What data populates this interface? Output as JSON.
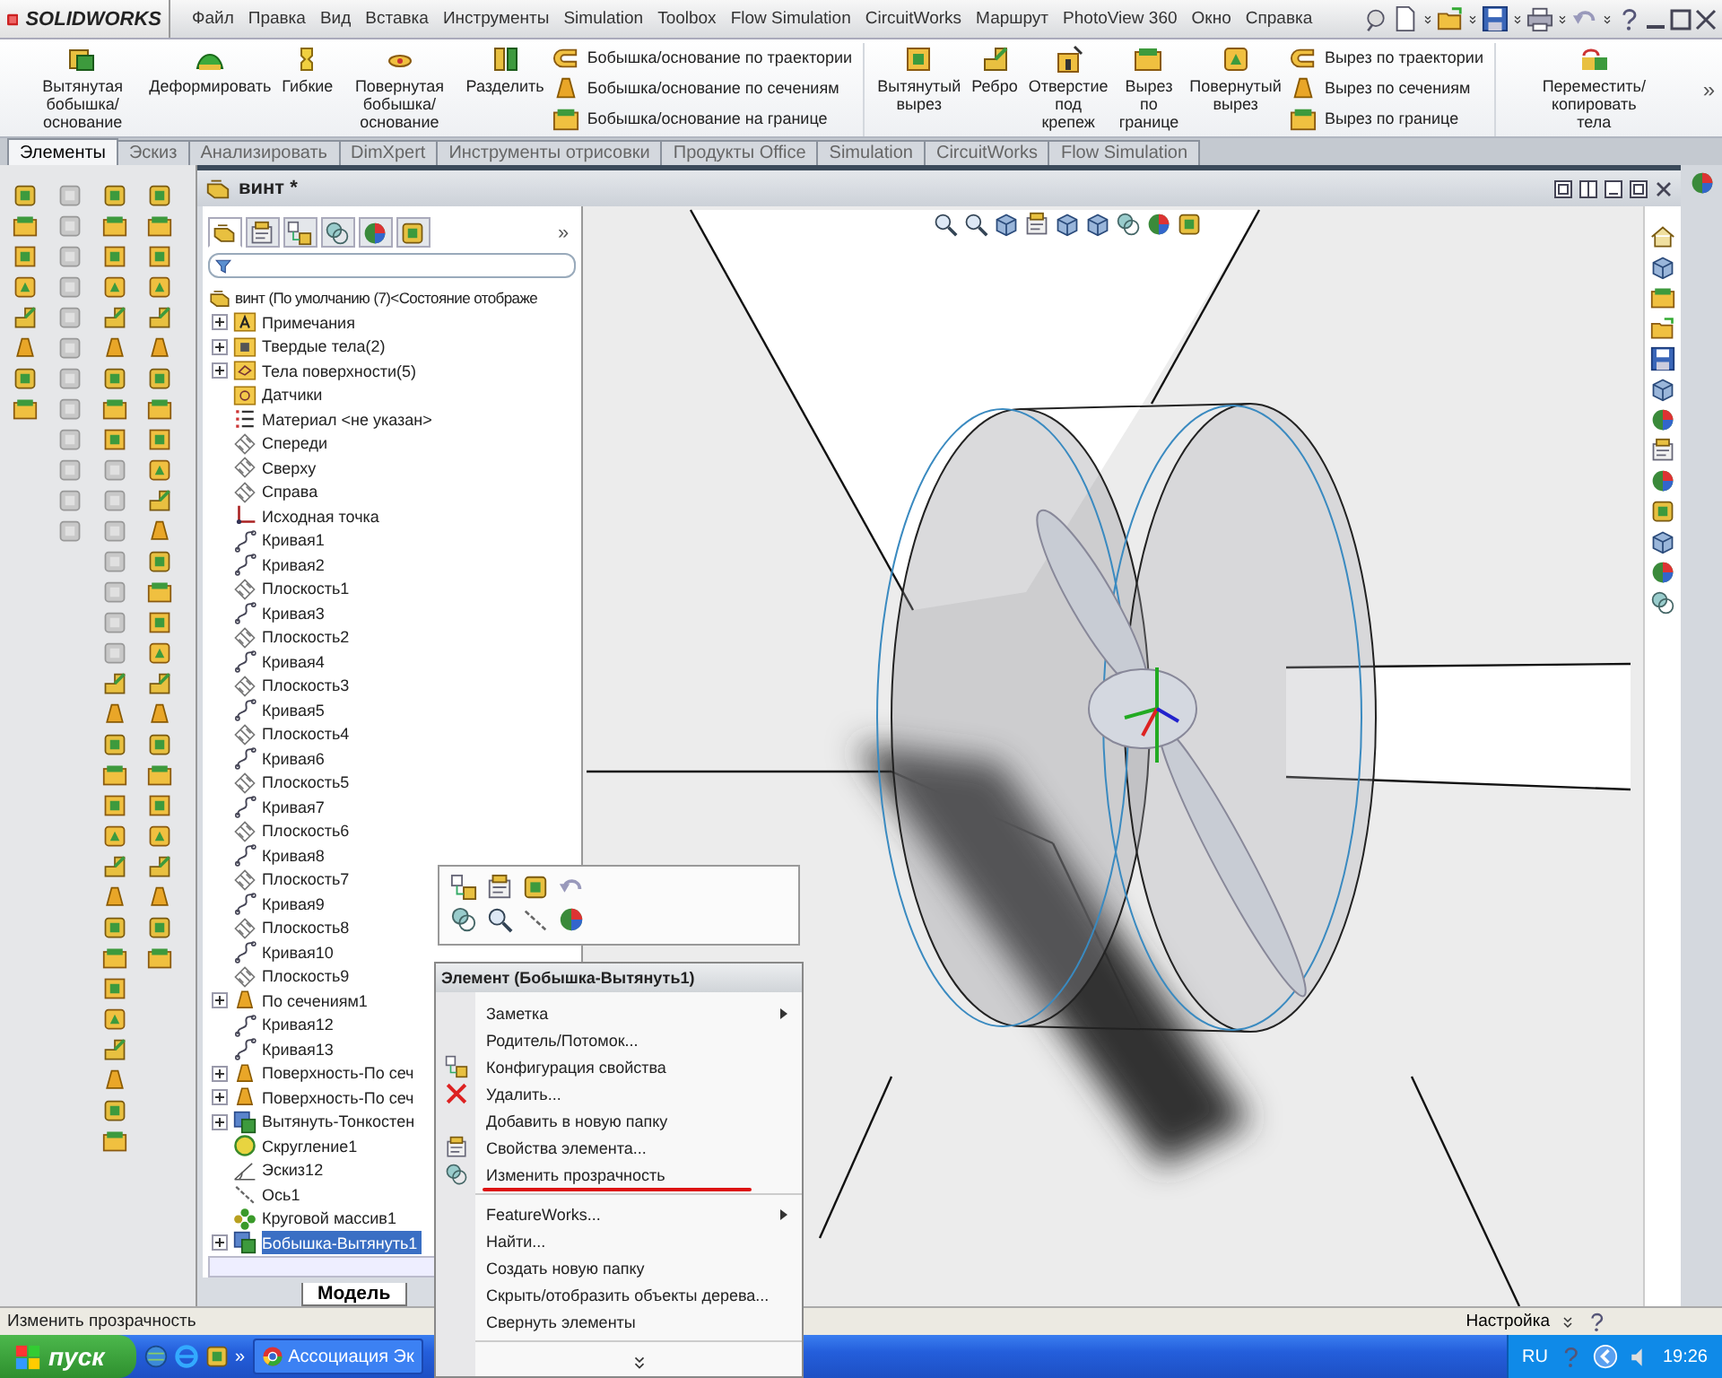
{
  "app": {
    "logo": "SOLIDWORKS",
    "menus": [
      "Файл",
      "Правка",
      "Вид",
      "Вставка",
      "Инструменты",
      "Simulation",
      "Toolbox",
      "Flow Simulation",
      "CircuitWorks",
      "Маршрут",
      "PhotoView 360",
      "Окно",
      "Справка"
    ]
  },
  "ribbon": {
    "groups": [
      {
        "items": [
          {
            "kind": "large",
            "label": "Вытянутая\nбобышка/основание"
          },
          {
            "kind": "large",
            "label": "Деформировать"
          },
          {
            "kind": "large",
            "label": "Гибкие"
          },
          {
            "kind": "large",
            "label": "Повернутая\nбобышка/основание"
          },
          {
            "kind": "large",
            "label": "Разделить"
          },
          {
            "kind": "stack",
            "entries": [
              "Бобышка/основание по траектории",
              "Бобышка/основание по сечениям",
              "Бобышка/основание на границе"
            ]
          }
        ]
      },
      {
        "items": [
          {
            "kind": "large",
            "label": "Вытянутый\nвырез"
          },
          {
            "kind": "large",
            "label": "Ребро"
          },
          {
            "kind": "large",
            "label": "Отверстие\nпод\nкрепеж"
          },
          {
            "kind": "large",
            "label": "Вырез\nпо\nгранице"
          },
          {
            "kind": "large",
            "label": "Повернутый\nвырез"
          },
          {
            "kind": "stack",
            "entries": [
              "Вырез по траектории",
              "Вырез по сечениям",
              "Вырез по границе"
            ]
          }
        ]
      },
      {
        "items": [
          {
            "kind": "large",
            "label": "Переместить/копировать\nтела"
          }
        ]
      }
    ],
    "more": "»"
  },
  "tabs": [
    {
      "label": "Элементы",
      "selected": true
    },
    {
      "label": "Эскиз",
      "selected": false
    },
    {
      "label": "Анализировать",
      "selected": false
    },
    {
      "label": "DimXpert",
      "selected": false
    },
    {
      "label": "Инструменты отрисовки",
      "selected": false
    },
    {
      "label": "Продукты Office",
      "selected": false
    },
    {
      "label": "Simulation",
      "selected": false
    },
    {
      "label": "CircuitWorks",
      "selected": false
    },
    {
      "label": "Flow Simulation",
      "selected": false
    }
  ],
  "document": {
    "title": "винт *"
  },
  "feature_tree": {
    "panel_tabs": [
      {
        "selected": true
      },
      {
        "selected": false
      },
      {
        "selected": false
      },
      {
        "selected": false
      },
      {
        "selected": false
      },
      {
        "selected": false
      }
    ],
    "more": "»",
    "root": "винт  (По умолчанию (7)<Состояние отображе",
    "items": [
      {
        "label": "Примечания",
        "kind": "annotation",
        "expandable": true,
        "selected": false
      },
      {
        "label": "Твердые тела(2)",
        "kind": "solid",
        "expandable": true,
        "selected": false
      },
      {
        "label": "Тела поверхности(5)",
        "kind": "surfacefolder",
        "expandable": true,
        "selected": false
      },
      {
        "label": "Датчики",
        "kind": "sensor",
        "expandable": false,
        "selected": false
      },
      {
        "label": "Материал <не указан>",
        "kind": "material",
        "expandable": false,
        "selected": false
      },
      {
        "label": "Спереди",
        "kind": "plane",
        "expandable": false,
        "selected": false
      },
      {
        "label": "Сверху",
        "kind": "plane",
        "expandable": false,
        "selected": false
      },
      {
        "label": "Справа",
        "kind": "plane",
        "expandable": false,
        "selected": false
      },
      {
        "label": "Исходная точка",
        "kind": "origin",
        "expandable": false,
        "selected": false
      },
      {
        "label": "Кривая1",
        "kind": "curve",
        "expandable": false,
        "selected": false
      },
      {
        "label": "Кривая2",
        "kind": "curve",
        "expandable": false,
        "selected": false
      },
      {
        "label": "Плоскость1",
        "kind": "plane",
        "expandable": false,
        "selected": false
      },
      {
        "label": "Кривая3",
        "kind": "curve",
        "expandable": false,
        "selected": false
      },
      {
        "label": "Плоскость2",
        "kind": "plane",
        "expandable": false,
        "selected": false
      },
      {
        "label": "Кривая4",
        "kind": "curve",
        "expandable": false,
        "selected": false
      },
      {
        "label": "Плоскость3",
        "kind": "plane",
        "expandable": false,
        "selected": false
      },
      {
        "label": "Кривая5",
        "kind": "curve",
        "expandable": false,
        "selected": false
      },
      {
        "label": "Плоскость4",
        "kind": "plane",
        "expandable": false,
        "selected": false
      },
      {
        "label": "Кривая6",
        "kind": "curve",
        "expandable": false,
        "selected": false
      },
      {
        "label": "Плоскость5",
        "kind": "plane",
        "expandable": false,
        "selected": false
      },
      {
        "label": "Кривая7",
        "kind": "curve",
        "expandable": false,
        "selected": false
      },
      {
        "label": "Плоскость6",
        "kind": "plane",
        "expandable": false,
        "selected": false
      },
      {
        "label": "Кривая8",
        "kind": "curve",
        "expandable": false,
        "selected": false
      },
      {
        "label": "Плоскость7",
        "kind": "plane",
        "expandable": false,
        "selected": false
      },
      {
        "label": "Кривая9",
        "kind": "curve",
        "expandable": false,
        "selected": false
      },
      {
        "label": "Плоскость8",
        "kind": "plane",
        "expandable": false,
        "selected": false
      },
      {
        "label": "Кривая10",
        "kind": "curve",
        "expandable": false,
        "selected": false
      },
      {
        "label": "Плоскость9",
        "kind": "plane",
        "expandable": false,
        "selected": false
      },
      {
        "label": "По сечениям1",
        "kind": "loft",
        "expandable": true,
        "selected": false
      },
      {
        "label": "Кривая12",
        "kind": "curve",
        "expandable": false,
        "selected": false
      },
      {
        "label": "Кривая13",
        "kind": "curve",
        "expandable": false,
        "selected": false
      },
      {
        "label": "Поверхность-По сеч",
        "kind": "loft",
        "expandable": true,
        "selected": false
      },
      {
        "label": "Поверхность-По сеч",
        "kind": "loft",
        "expandable": true,
        "selected": false
      },
      {
        "label": "Вытянуть-Тонкостен",
        "kind": "extrude",
        "expandable": true,
        "selected": false
      },
      {
        "label": "Скругление1",
        "kind": "fillet",
        "expandable": false,
        "selected": false
      },
      {
        "label": "Эскиз12",
        "kind": "sketch",
        "expandable": false,
        "selected": false
      },
      {
        "label": "Ось1",
        "kind": "axis",
        "expandable": false,
        "selected": false
      },
      {
        "label": "Круговой массив1",
        "kind": "pattern",
        "expandable": false,
        "selected": false
      },
      {
        "label": "Бобышка-Вытянуть1",
        "kind": "extrude",
        "expandable": true,
        "selected": true
      }
    ],
    "bottom_tabs": [
      {
        "label": "Модель",
        "selected": true
      }
    ]
  },
  "context_menu": {
    "title": "Элемент (Бобышка-Вытянуть1)",
    "items": [
      {
        "kind": "item",
        "label": "Заметка",
        "submenu": true,
        "highlighted": false
      },
      {
        "kind": "item",
        "label": "Родитель/Потомок...",
        "submenu": false,
        "highlighted": false
      },
      {
        "kind": "item",
        "label": "Конфигурация свойства",
        "submenu": false,
        "highlighted": false
      },
      {
        "kind": "item",
        "label": "Удалить...",
        "submenu": false,
        "highlighted": false
      },
      {
        "kind": "item",
        "label": "Добавить в новую папку",
        "submenu": false,
        "highlighted": false
      },
      {
        "kind": "item",
        "label": "Свойства элемента...",
        "submenu": false,
        "highlighted": false
      },
      {
        "kind": "item",
        "label": "Изменить прозрачность",
        "submenu": false,
        "highlighted": true
      },
      {
        "kind": "separator"
      },
      {
        "kind": "item",
        "label": "FeatureWorks...",
        "submenu": true,
        "highlighted": false
      },
      {
        "kind": "item",
        "label": "Найти...",
        "submenu": false,
        "highlighted": false
      },
      {
        "kind": "item",
        "label": "Создать новую папку",
        "submenu": false,
        "highlighted": false
      },
      {
        "kind": "item",
        "label": "Скрыть/отобразить объекты дерева...",
        "submenu": false,
        "highlighted": false
      },
      {
        "kind": "item",
        "label": "Свернуть элементы",
        "submenu": false,
        "highlighted": false
      },
      {
        "kind": "separator"
      },
      {
        "kind": "expand"
      }
    ]
  },
  "status_bar": {
    "message": "Изменить прозрачность",
    "settings": "Настройка"
  },
  "taskbar": {
    "start": "пуск",
    "more": "»",
    "tasks": [
      {
        "label": "Ассоциация Эк"
      }
    ],
    "language": "RU",
    "clock": "19:26"
  }
}
